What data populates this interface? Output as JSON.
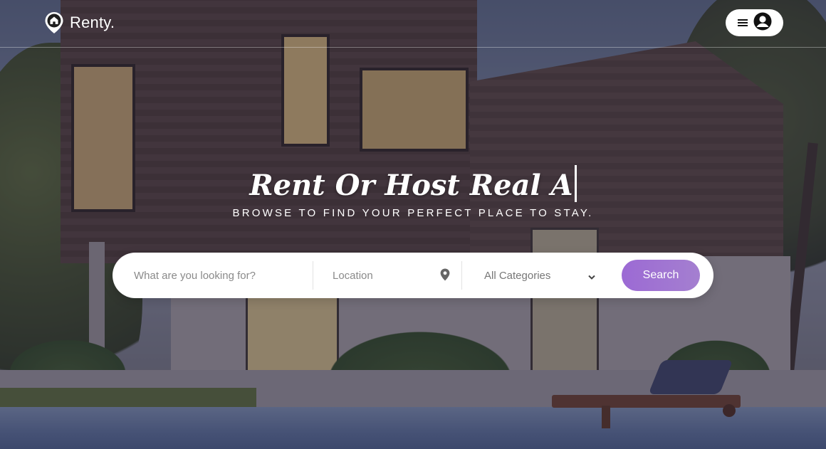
{
  "brand": {
    "name": "Renty."
  },
  "hero": {
    "title": "Rent Or Host Real A",
    "subtitle": "BROWSE TO FIND YOUR PERFECT PLACE TO STAY."
  },
  "search": {
    "keyword_placeholder": "What are you looking for?",
    "location_placeholder": "Location",
    "category_value": "All Categories",
    "button_label": "Search"
  },
  "colors": {
    "accent": "#9c6ad4",
    "text_on_hero": "#ffffff"
  },
  "icons": {
    "logo": "home-pin-icon",
    "menu": "hamburger-icon",
    "user": "user-circle-icon",
    "location": "map-marker-icon",
    "category": "chevron-down-icon"
  }
}
